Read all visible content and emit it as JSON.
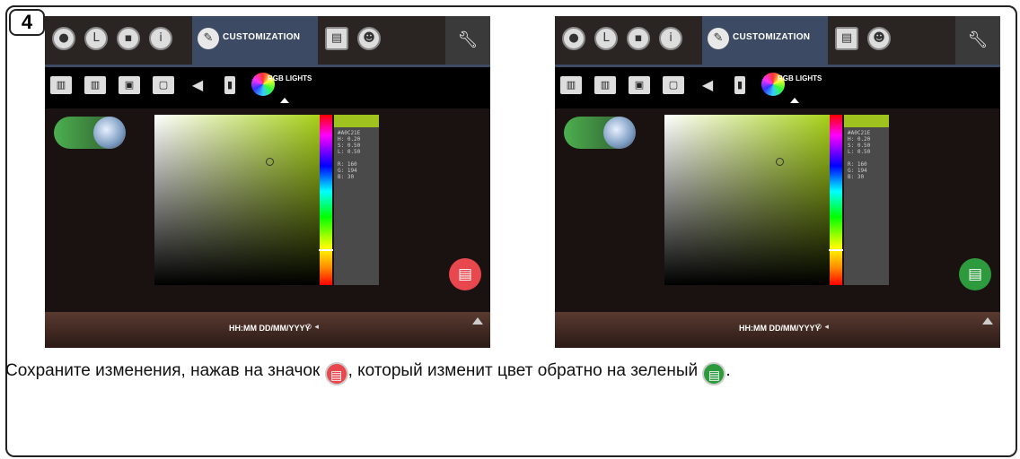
{
  "step_number": "4",
  "screens": [
    {
      "state": "unsaved",
      "save_icon": "save-icon",
      "save_color": "#e8474d"
    },
    {
      "state": "saved",
      "save_icon": "save-icon",
      "save_color": "#2e9a3e"
    }
  ],
  "ui": {
    "customization_label": "CUSTOMIZATION",
    "rgb_lights_label": "RGB LIGHTS",
    "info_text": "#A0C21E\nH: 0.20\nS: 0.50\nL: 0.50\n\nR: 160\nG: 194\nB: 30",
    "time_format": "HH:MM DD/MM/YYYY",
    "status_icons": "⊙ ◂"
  },
  "caption": {
    "part1": "Сохраните изменения, нажав на значок ",
    "part2": ", который изменит цвет обратно на зеленый ",
    "part3": "."
  },
  "colors": {
    "red_icon": "#e8474d",
    "green_icon": "#2e9a3e",
    "accent_tab": "#3d4a64"
  }
}
